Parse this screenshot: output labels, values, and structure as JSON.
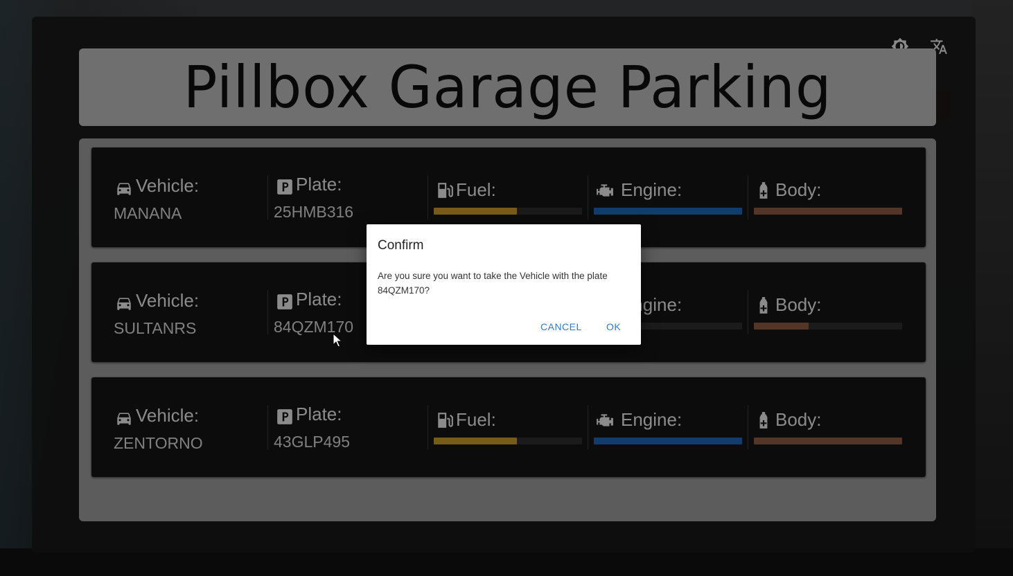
{
  "page": {
    "title": "Pillbox Garage Parking"
  },
  "toolbar": {
    "theme_icon": "brightness-icon",
    "language_icon": "translate-icon"
  },
  "labels": {
    "vehicle": "Vehicle:",
    "plate": "Plate:",
    "fuel": "Fuel:",
    "engine": "Engine:",
    "body": "Body:"
  },
  "colors": {
    "fuel": "#c79a2a",
    "engine": "#1f64b4",
    "body": "#8a5a44"
  },
  "vehicles": [
    {
      "name": "MANANA",
      "plate": "25HMB316",
      "fuel": 0.56,
      "engine": 1.0,
      "body": 1.0
    },
    {
      "name": "SULTANRS",
      "plate": "84QZM170",
      "fuel": null,
      "engine": 0.02,
      "body": 0.37
    },
    {
      "name": "ZENTORNO",
      "plate": "43GLP495",
      "fuel": 0.56,
      "engine": 1.0,
      "body": 1.0
    }
  ],
  "dialog": {
    "title": "Confirm",
    "message": "Are you sure you want to take the Vehicle with the plate 84QZM170?",
    "cancel_label": "CANCEL",
    "ok_label": "OK"
  }
}
